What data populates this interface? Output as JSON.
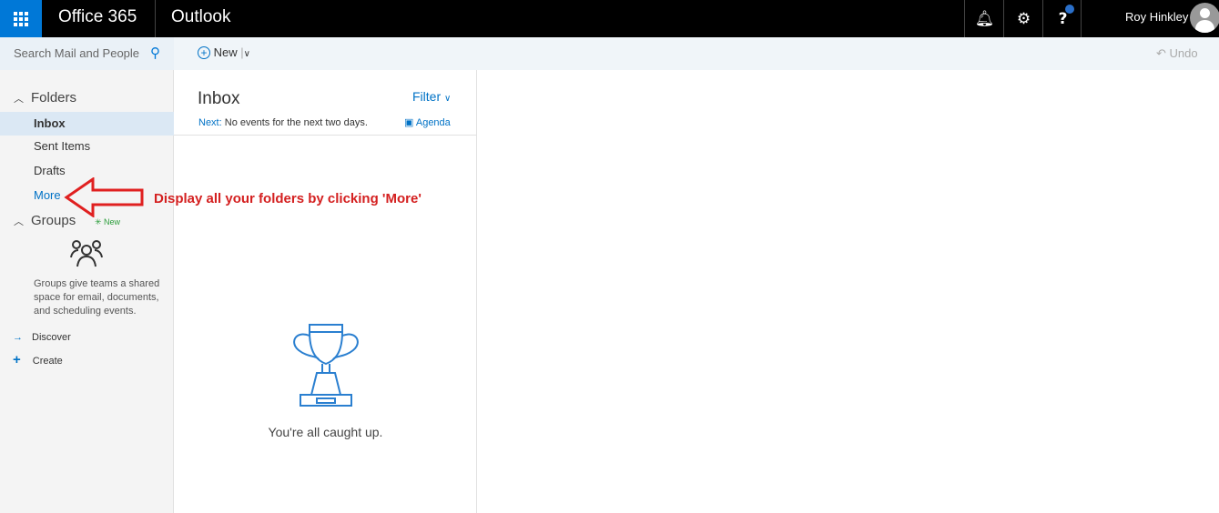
{
  "header": {
    "brand": "Office 365",
    "app": "Outlook",
    "user_name": "Roy Hinkley"
  },
  "search": {
    "placeholder": "Search Mail and People"
  },
  "toolbar": {
    "new_label": "New",
    "undo_label": "Undo"
  },
  "sidebar": {
    "folders_heading": "Folders",
    "folders": [
      {
        "label": "Inbox"
      },
      {
        "label": "Sent Items"
      },
      {
        "label": "Drafts"
      }
    ],
    "more_label": "More",
    "groups_heading": "Groups",
    "groups_badge": "New",
    "groups_description": "Groups give teams a shared space for email, documents, and scheduling events.",
    "discover_label": "Discover",
    "create_label": "Create"
  },
  "list": {
    "title": "Inbox",
    "filter_label": "Filter",
    "next_label": "Next:",
    "next_text": "No events for the next two days.",
    "agenda_label": "Agenda",
    "empty_text": "You're all caught up."
  },
  "annotation": {
    "text": "Display all your folders by clicking 'More'"
  }
}
